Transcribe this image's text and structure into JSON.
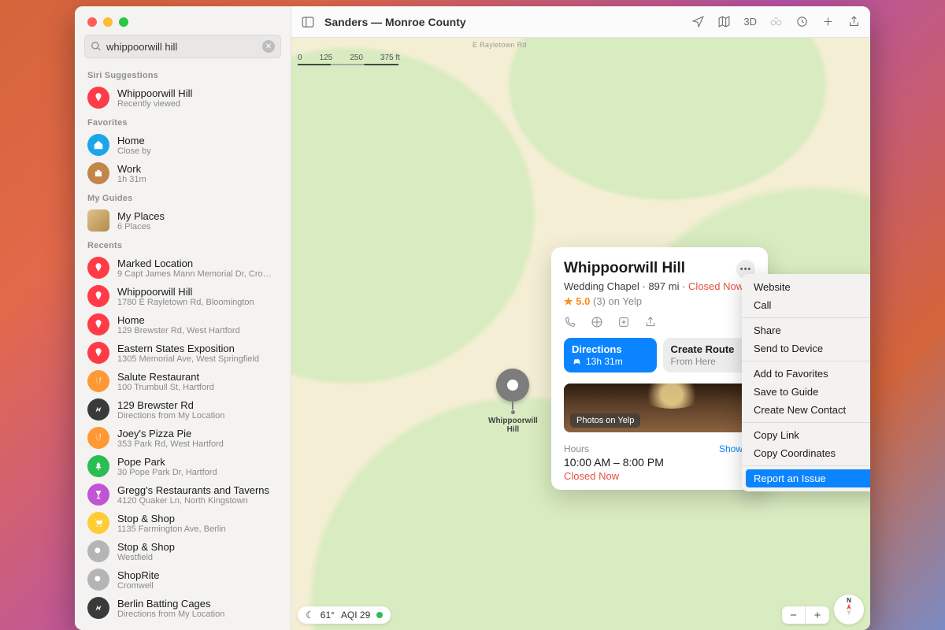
{
  "window": {
    "title": "Sanders — Monroe County"
  },
  "search": {
    "value": "whippoorwill hill"
  },
  "sections": {
    "siri": "Siri Suggestions",
    "fav": "Favorites",
    "guides": "My Guides",
    "recents": "Recents"
  },
  "siri": {
    "title": "Whippoorwill Hill",
    "sub": "Recently viewed"
  },
  "fav": [
    {
      "title": "Home",
      "sub": "Close by",
      "color": "#1aa6e8",
      "icon": "home"
    },
    {
      "title": "Work",
      "sub": "1h 31m",
      "color": "#c3864a",
      "icon": "work"
    }
  ],
  "guide": {
    "title": "My Places",
    "sub": "6 Places"
  },
  "recents": [
    {
      "title": "Marked Location",
      "sub": "9 Capt James Mann Memorial Dr, Cromw…",
      "color": "#ff3b47",
      "icon": "pin"
    },
    {
      "title": "Whippoorwill Hill",
      "sub": "1780 E Rayletown Rd, Bloomington",
      "color": "#ff3b47",
      "icon": "pin"
    },
    {
      "title": "Home",
      "sub": "129 Brewster Rd, West Hartford",
      "color": "#ff3b47",
      "icon": "pin"
    },
    {
      "title": "Eastern States Exposition",
      "sub": "1305 Memorial Ave, West Springfield",
      "color": "#ff3b47",
      "icon": "pin"
    },
    {
      "title": "Salute Restaurant",
      "sub": "100 Trumbull St, Hartford",
      "color": "#ff9933",
      "icon": "fork"
    },
    {
      "title": "129 Brewster Rd",
      "sub": "Directions from My Location",
      "color": "#3a3a3a",
      "icon": "route"
    },
    {
      "title": "Joey's Pizza Pie",
      "sub": "353 Park Rd, West Hartford",
      "color": "#ff9933",
      "icon": "fork"
    },
    {
      "title": "Pope Park",
      "sub": "30 Pope Park Dr, Hartford",
      "color": "#2bbd52",
      "icon": "tree"
    },
    {
      "title": "Gregg's Restaurants and Taverns",
      "sub": "4120 Quaker Ln, North Kingstown",
      "color": "#c154d6",
      "icon": "drink"
    },
    {
      "title": "Stop & Shop",
      "sub": "1135 Farmington Ave, Berlin",
      "color": "#ffcc33",
      "icon": "cart"
    },
    {
      "title": "Stop & Shop",
      "sub": "Westfield",
      "color": "#b5b5b5",
      "icon": "mag"
    },
    {
      "title": "ShopRite",
      "sub": "Cromwell",
      "color": "#b5b5b5",
      "icon": "mag"
    },
    {
      "title": "Berlin Batting Cages",
      "sub": "Directions from My Location",
      "color": "#3a3a3a",
      "icon": "route"
    }
  ],
  "toolbar": {
    "threeD": "3D"
  },
  "mapScale": {
    "t0": "0",
    "t1": "125",
    "t2": "250",
    "t3": "375 ft"
  },
  "road": "E Rayletown Rd",
  "pin": {
    "line1": "Whippoorwill",
    "line2": "Hill"
  },
  "card": {
    "title": "Whippoorwill Hill",
    "category": "Wedding Chapel",
    "distance": "897 mi",
    "closed": "Closed Now",
    "rating": "5.0",
    "reviews": "(3)",
    "source": "on Yelp",
    "dir": {
      "label": "Directions",
      "time": "13h 31m"
    },
    "route": {
      "label": "Create Route",
      "sub": "From Here"
    },
    "photosCap": "Photos on Yelp",
    "hoursLabel": "Hours",
    "showAll": "Show All",
    "hoursTime": "10:00 AM – 8:00 PM",
    "hoursStatus": "Closed Now"
  },
  "menu": {
    "website": "Website",
    "call": "Call",
    "share": "Share",
    "sendto": "Send to Device",
    "addfav": "Add to Favorites",
    "saveguide": "Save to Guide",
    "newcontact": "Create New Contact",
    "copylink": "Copy Link",
    "copycoord": "Copy Coordinates",
    "report": "Report an Issue"
  },
  "weather": {
    "temp": "61°",
    "aqi": "AQI 29"
  },
  "compass": "N"
}
